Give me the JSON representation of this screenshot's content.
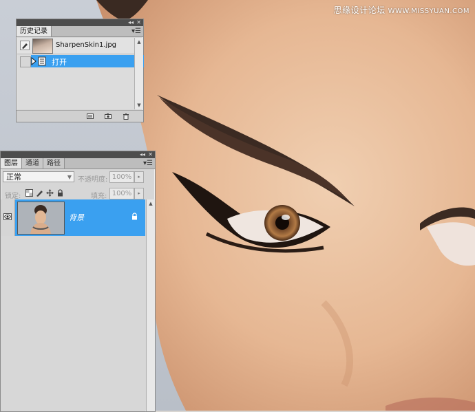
{
  "watermark": {
    "text": "思缘设计论坛",
    "site": "WWW.MISSYUAN.COM"
  },
  "history_panel": {
    "tab": "历史记录",
    "snapshot": {
      "name": "SharpenSkin1.jpg"
    },
    "steps": [
      {
        "label": "打开",
        "selected": true
      }
    ],
    "icons": [
      "new-document-from-state-icon",
      "new-snapshot-icon",
      "trash-icon"
    ]
  },
  "layers_panel": {
    "tabs": [
      {
        "label": "图层",
        "active": true
      },
      {
        "label": "通道",
        "active": false
      },
      {
        "label": "路径",
        "active": false
      }
    ],
    "blend_mode": "正常",
    "opacity_label": "不透明度:",
    "opacity_value": "100%",
    "lock_label": "锁定:",
    "fill_label": "填充:",
    "fill_value": "100%",
    "layers": [
      {
        "name": "背景",
        "visible": true,
        "locked": true,
        "selected": true
      }
    ]
  },
  "colors": {
    "selection": "#3aa0f0",
    "panel_bg": "#d6d6d6",
    "titlebar": "#4d4d4d"
  }
}
